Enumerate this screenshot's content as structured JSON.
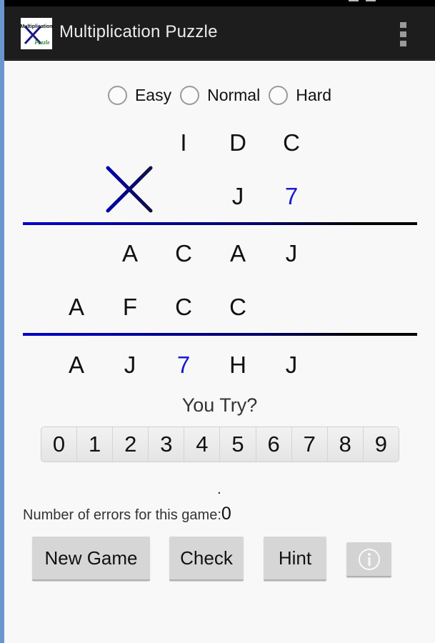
{
  "app": {
    "title": "Multiplication Puzzle",
    "logo_text_top": "Multiplication",
    "logo_text_bottom": "Puzzle",
    "overflow_icon": "overflow-menu-icon"
  },
  "difficulty": {
    "options": [
      {
        "label": "Easy",
        "selected": false
      },
      {
        "label": "Normal",
        "selected": false
      },
      {
        "label": "Hard",
        "selected": false
      }
    ]
  },
  "puzzle": {
    "multiplicand": [
      "I",
      "D",
      "C"
    ],
    "multiplier": [
      "J",
      "7"
    ],
    "operator_icon": "multiply-icon",
    "partial_product_1": [
      "A",
      "C",
      "A",
      "J"
    ],
    "partial_product_2": [
      "A",
      "F",
      "C",
      "C"
    ],
    "result": [
      "A",
      "J",
      "7",
      "H",
      "J"
    ],
    "revealed_color": "#1a1ad0"
  },
  "input": {
    "prompt": "You Try?",
    "digits": [
      "0",
      "1",
      "2",
      "3",
      "4",
      "5",
      "6",
      "7",
      "8",
      "9"
    ],
    "selection_marker": "."
  },
  "status": {
    "errors_label": "Number of errors for this game:",
    "errors_count": "0"
  },
  "buttons": {
    "new_game": "New Game",
    "check": "Check",
    "hint": "Hint",
    "info_icon": "info-icon"
  }
}
